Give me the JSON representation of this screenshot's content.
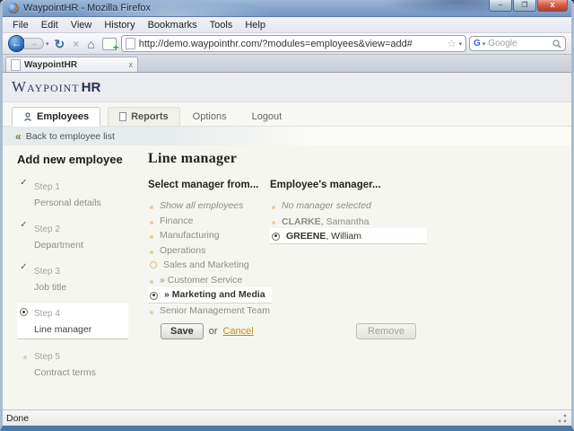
{
  "window": {
    "title": "WaypointHR - Mozilla Firefox",
    "minimize": "–",
    "maximize": "❐",
    "close": "x"
  },
  "menu": {
    "items": [
      "File",
      "Edit",
      "View",
      "History",
      "Bookmarks",
      "Tools",
      "Help"
    ]
  },
  "toolbar": {
    "back": "←",
    "forward": "→",
    "caret": "▾",
    "reload": "↻",
    "stop": "×",
    "home": "⌂",
    "url": "http://demo.waypointhr.com/?modules=employees&view=add#",
    "star": "☆",
    "url_caret": "▾",
    "search_logo": "G",
    "search_caret": "▾",
    "search_placeholder": "Google"
  },
  "browser_tab": {
    "label": "WaypointHR",
    "close": "x"
  },
  "site": {
    "logo_word": "Waypoint",
    "logo_hr": "HR"
  },
  "nav": {
    "tabs": [
      {
        "label": "Employees"
      },
      {
        "label": "Reports"
      },
      {
        "label": "Options"
      },
      {
        "label": "Logout"
      }
    ]
  },
  "back_bar": {
    "arrow": "«",
    "label": "Back to employee list"
  },
  "wizard": {
    "heading": "Add new employee",
    "check": "✓",
    "steps": [
      {
        "step": "Step 1",
        "label": "Personal details",
        "state": "done"
      },
      {
        "step": "Step 2",
        "label": "Department",
        "state": "done"
      },
      {
        "step": "Step 3",
        "label": "Job title",
        "state": "done"
      },
      {
        "step": "Step 4",
        "label": "Line manager",
        "state": "current"
      },
      {
        "step": "Step 5",
        "label": "Contract terms",
        "state": "todo"
      }
    ]
  },
  "main": {
    "heading": "Line manager",
    "left": {
      "heading": "Select manager from...",
      "items": [
        {
          "label": "Show all employees"
        },
        {
          "label": "Finance"
        },
        {
          "label": "Manufacturing"
        },
        {
          "label": "Operations"
        },
        {
          "label": "Sales and Marketing"
        },
        {
          "label": "» Customer Service"
        },
        {
          "label": "» Marketing and Media"
        },
        {
          "label": "Senior Management Team"
        }
      ]
    },
    "right": {
      "heading": "Employee's manager...",
      "items": [
        {
          "label": "No manager selected"
        },
        {
          "surname": "CLARKE",
          "rest": ", Samantha"
        },
        {
          "surname": "GREENE",
          "rest": ", William"
        }
      ]
    },
    "save_label": "Save",
    "or_label": "or",
    "cancel_label": "Cancel",
    "remove_label": "Remove"
  },
  "statusbar": {
    "text": "Done"
  },
  "colors": {
    "accent_orange": "#c8861e",
    "bullet_tan": "#e7cfa4",
    "logo_navy": "#2e3b5e",
    "titlebar_blue": "#87a6cc"
  }
}
